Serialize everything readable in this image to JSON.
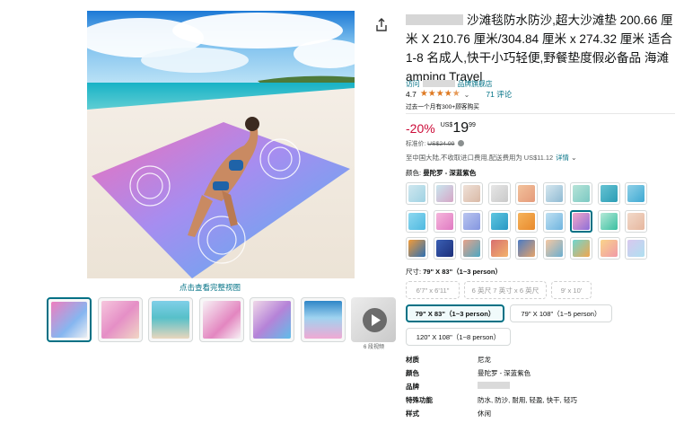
{
  "product": {
    "title": "沙滩毯防水防沙,超大沙滩垫 200.66 厘米 X 210.76 厘米/304.84 厘米 x 274.32 厘米 适合 1-8 名成人,快干小巧轻便,野餐垫度假必备品 海滩 amping Travel",
    "store_prefix": "访问",
    "store_suffix": "品牌旗舰店",
    "rating": "4.7",
    "review_count": "71 评论",
    "bought_text": "过去一个月有300+顾客购买"
  },
  "price": {
    "discount": "-20%",
    "currency": "US$",
    "whole": "19",
    "fraction": "99",
    "list_label": "标准价:",
    "list_value": "US$24.99",
    "shipping": "至中国大陆,不收取进口费用,配送费用为 US$11.12",
    "shipping_details": "详情"
  },
  "color": {
    "label": "颜色:",
    "selected": "曼陀罗 - 深蓝紫色",
    "swatch_colors": [
      [
        "#cfe7ef",
        "#9fd2e3"
      ],
      [
        "#c9e6ee",
        "#d6a6c7"
      ],
      [
        "#efe1d8",
        "#d9b9a6"
      ],
      [
        "#e6e6e6",
        "#c9c9c9"
      ],
      [
        "#f2c29c",
        "#e59a7a"
      ],
      [
        "#d6e7ef",
        "#8fbad3"
      ],
      [
        "#b7e4d8",
        "#7cc9c3"
      ],
      [
        "#66c3d3",
        "#2b9db5"
      ],
      [
        "#8fd0e8",
        "#3fa9d2"
      ],
      [
        "#8ed8f0",
        "#4fb9e0"
      ],
      [
        "#f5b6dc",
        "#e07ac2"
      ],
      [
        "#b9c5ef",
        "#8496e0"
      ],
      [
        "#5ec6e0",
        "#2a98c4"
      ],
      [
        "#f6b35b",
        "#e88a2c"
      ],
      [
        "#bfe0f2",
        "#6fb4df"
      ],
      [
        "#f5a7c8",
        "#8c6fd8"
      ],
      [
        "#b4e9d7",
        "#3bbfa1"
      ],
      [
        "#f2d9c9",
        "#e6b79f"
      ],
      [
        "#f29b38",
        "#2b6fb4"
      ],
      [
        "#3a5fb4",
        "#1c2f7a"
      ],
      [
        "#e8a38a",
        "#4aa6c2"
      ],
      [
        "#d86f6f",
        "#f2b36b"
      ],
      [
        "#4b7bc4",
        "#e5a36a"
      ],
      [
        "#f6c8a2",
        "#6aaed0"
      ],
      [
        "#6fd6d0",
        "#f1a64d"
      ],
      [
        "#fad48a",
        "#f09aa8"
      ],
      [
        "#d9c8ef",
        "#aee0f0"
      ]
    ]
  },
  "size": {
    "label": "尺寸:",
    "selected": "79\" X 83\"（1~3 person）",
    "options_disabled": [
      "6'7\" x 6'11\"",
      "6 英尺 7 英寸 x 6 英尺",
      "9' x 10'"
    ],
    "options": [
      "79\" X 83\"（1~3 person）",
      "79\" X 108\"（1~5 person）",
      "120\" X 108\"（1~8 person）"
    ]
  },
  "gallery": {
    "view_full": "点击查看完整视图",
    "more": "6 段视频"
  },
  "specs": [
    {
      "key": "材质",
      "value": "尼龙"
    },
    {
      "key": "颜色",
      "value": "曼陀罗 - 深蓝紫色"
    },
    {
      "key": "品牌",
      "value": ""
    },
    {
      "key": "特殊功能",
      "value": "防水, 防沙, 耐用, 轻盈, 快干, 轻巧"
    },
    {
      "key": "样式",
      "value": "休闲"
    }
  ],
  "colors": {
    "link": "#007185",
    "star": "#de7921",
    "discount": "#cc0c39"
  }
}
